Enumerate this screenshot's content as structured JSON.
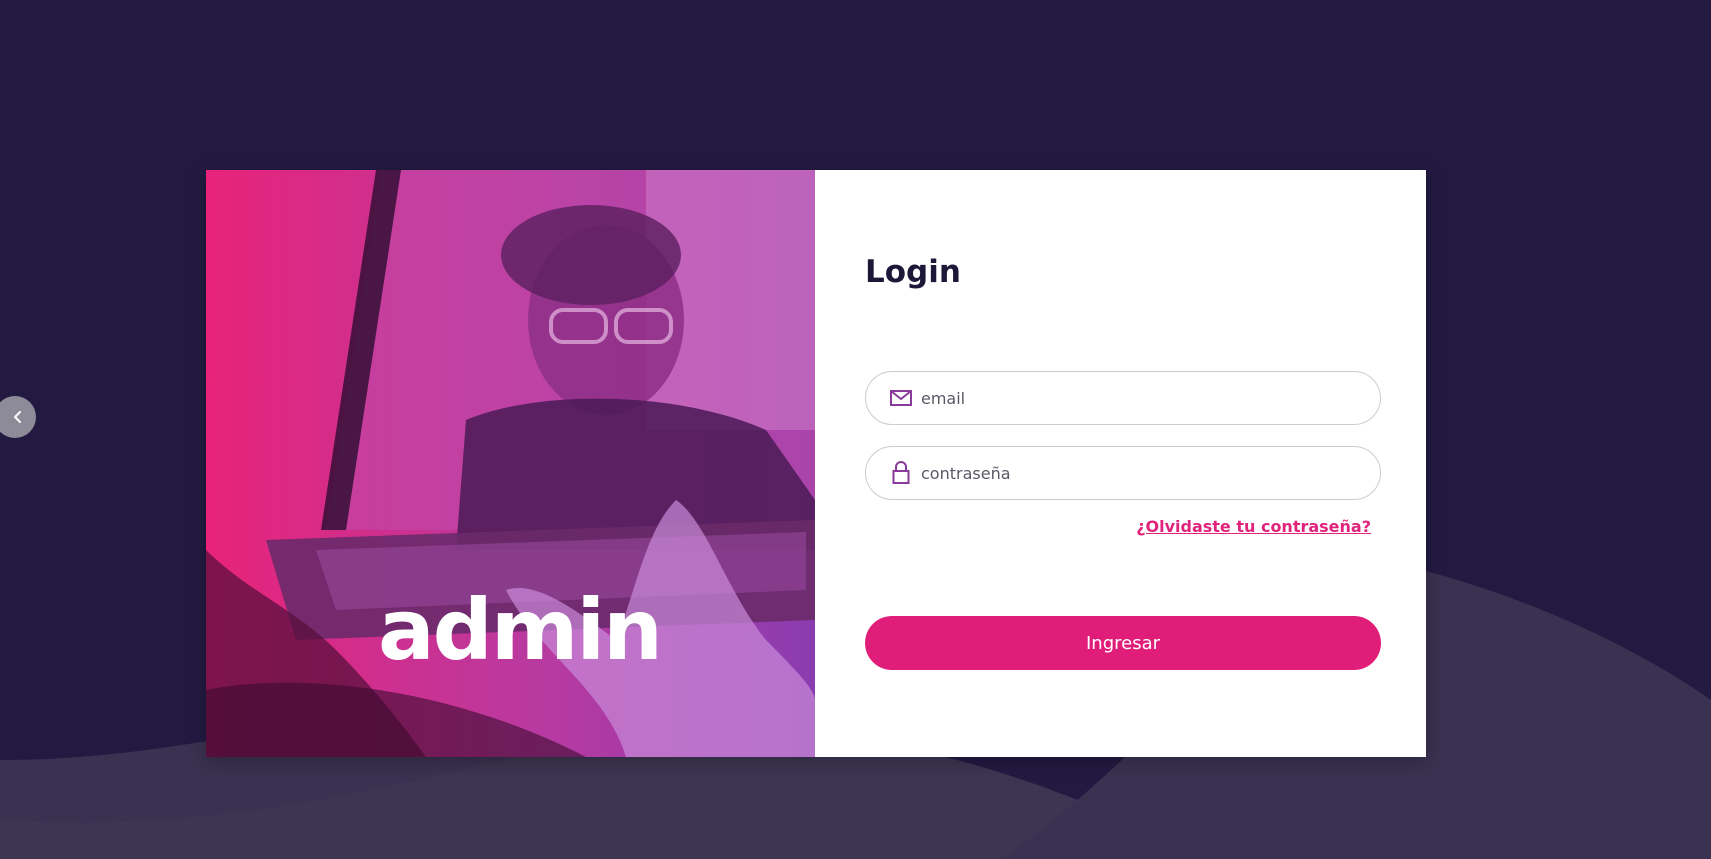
{
  "colors": {
    "background": "#231a42",
    "accent": "#e01e7a",
    "title": "#1d1838"
  },
  "hero": {
    "logo_text": "admin"
  },
  "login": {
    "title": "Login",
    "email_placeholder": "email",
    "email_value": "",
    "password_placeholder": "contraseña",
    "password_value": "",
    "forgot_password": "¿Olvidaste tu contraseña?",
    "submit_label": "Ingresar"
  },
  "icons": {
    "email": "envelope-icon",
    "password": "lock-icon",
    "carousel_prev": "chevron-left-icon"
  }
}
